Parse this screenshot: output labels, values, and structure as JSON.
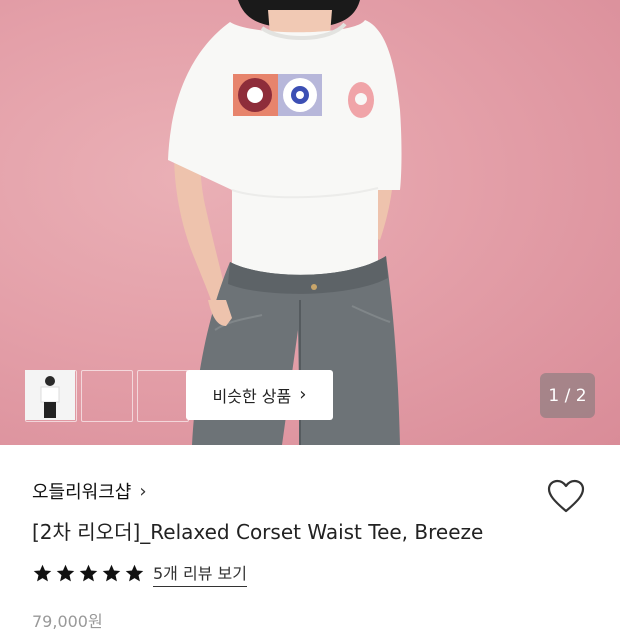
{
  "hero": {
    "similar_label": "비슷한 상품",
    "counter": "1 / 2",
    "thumbnails": [
      "thumbnail-1",
      "thumbnail-2",
      "thumbnail-3"
    ]
  },
  "product": {
    "brand": "오들리워크샵",
    "title": "[2차 리오더]_Relaxed Corset Waist Tee, Breeze",
    "rating_stars": 5,
    "review_link": "5개 리뷰 보기",
    "price": "79,000원"
  },
  "icons": [
    "chevron-right-icon",
    "heart-icon",
    "star-icon"
  ],
  "colors": {
    "background_pink": "#e4a0a9",
    "star": "#111111"
  }
}
